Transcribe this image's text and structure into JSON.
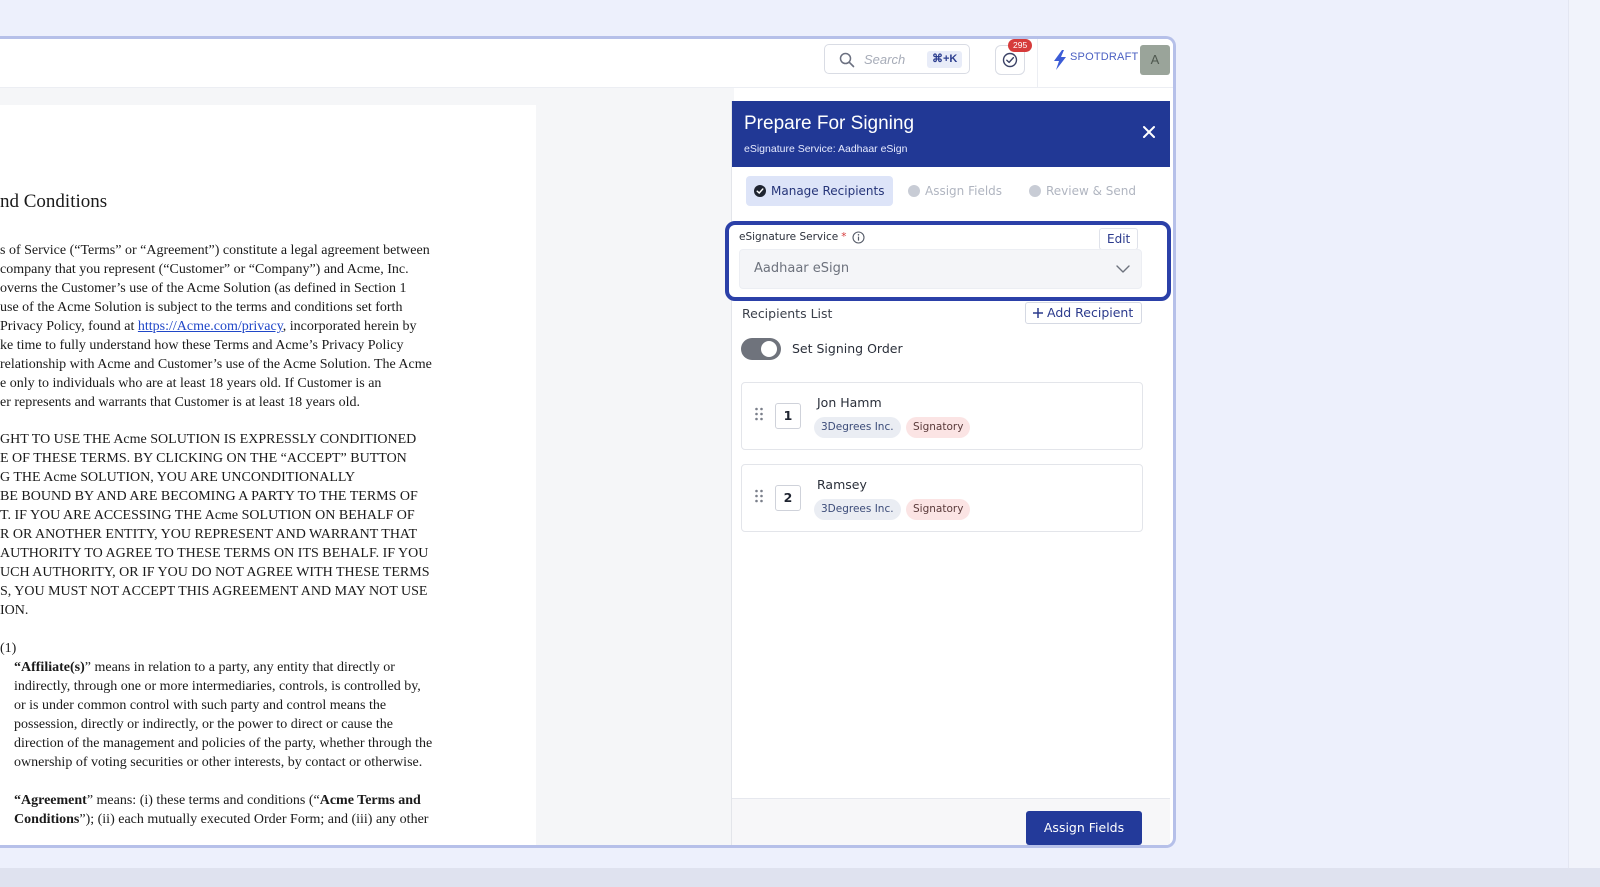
{
  "header": {
    "search_placeholder": "Search",
    "search_shortcut": "⌘+K",
    "notification_count": "295",
    "logo_text": "SPOTDRAFT",
    "avatar_initial": "A"
  },
  "document": {
    "title": "nd Conditions",
    "lines": [
      "s of Service (“Terms” or “Agreement”) constitute a legal agreement between",
      "company that you represent (“Customer” or “Company”) and Acme, Inc.",
      "overns the Customer’s use of the Acme Solution (as defined in Section 1",
      "use of the Acme Solution is subject to the terms and conditions set forth",
      "Privacy Policy, found at ",
      "ke time to fully understand how these Terms and Acme’s Privacy Policy",
      "relationship with Acme and Customer’s use of the Acme Solution. The Acme",
      "e only to individuals who are at least 18 years old. If Customer is an",
      "er represents and warrants that Customer is at least 18 years old.",
      "GHT TO USE THE Acme SOLUTION IS EXPRESSLY CONDITIONED",
      "E OF THESE TERMS. BY CLICKING ON THE “ACCEPT” BUTTON",
      "G THE Acme SOLUTION, YOU ARE UNCONDITIONALLY",
      " BE BOUND BY AND ARE BECOMING A PARTY TO THE TERMS OF",
      "T. IF YOU ARE ACCESSING THE Acme SOLUTION ON BEHALF OF",
      "R OR ANOTHER ENTITY, YOU REPRESENT AND WARRANT THAT",
      "AUTHORITY TO AGREE TO THESE TERMS ON ITS BEHALF. IF YOU",
      "UCH AUTHORITY, OR IF YOU DO NOT AGREE WITH THESE TERMS",
      "S, YOU MUST NOT ACCEPT THIS AGREEMENT AND MAY NOT USE",
      "ION.",
      "(1)",
      "” means in relation to a party, any entity that directly or",
      "indirectly, through one or more intermediaries, controls, is controlled by,",
      "or is under common control with such party and control means the",
      "possession, directly or indirectly, or the power to direct or cause the",
      "direction of the management and policies of the party, whether through the",
      "ownership of voting securities or other interests, by contact or otherwise.",
      "” means: (i) these terms and conditions (“",
      "”); (ii) each mutually executed Order Form; and (iii) any other"
    ],
    "privacy_link": "https://Acme.com/privacy",
    "privacy_suffix": ", incorporated herein by",
    "affiliate_term": "“Affiliate(s)",
    "agreement_term": "“Agreement",
    "acme_terms_bold": "Acme Terms and",
    "conditions_bold": "Conditions"
  },
  "panel": {
    "title": "Prepare For Signing",
    "subtitle": "eSignature Service: Aadhaar eSign",
    "steps": [
      {
        "label": "Manage Recipients"
      },
      {
        "label": "Assign Fields"
      },
      {
        "label": "Review & Send"
      }
    ],
    "esig_label": "eSignature Service",
    "required_mark": "*",
    "edit_label": "Edit",
    "esig_value": "Aadhaar eSign",
    "recipients_label": "Recipients List",
    "add_recipient_label": "Add Recipient",
    "signing_order_label": "Set Signing Order",
    "signing_order_on": true,
    "recipients": [
      {
        "order": "1",
        "name": "Jon Hamm",
        "org": "3Degrees Inc.",
        "role": "Signatory"
      },
      {
        "order": "2",
        "name": "Ramsey",
        "org": "3Degrees Inc.",
        "role": "Signatory"
      }
    ],
    "assign_button": "Assign Fields"
  },
  "colors": {
    "panel_header": "#213895",
    "highlight_border": "#2b40a8",
    "badge": "#d63b3b",
    "primary_button": "#233a9a"
  }
}
